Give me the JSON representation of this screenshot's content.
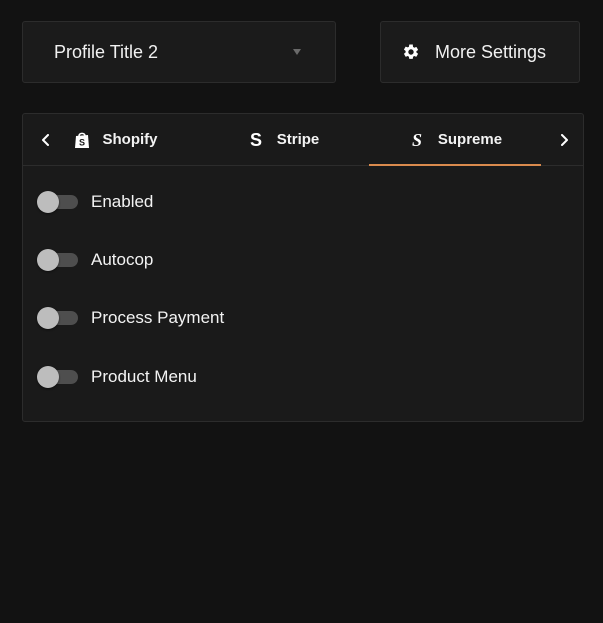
{
  "profile": {
    "selected": "Profile Title 2"
  },
  "more_settings": {
    "label": "More Settings",
    "icon": "gear-icon"
  },
  "tabs": {
    "items": [
      {
        "label": "Shopify",
        "icon": "shopify-bag-icon",
        "active": false
      },
      {
        "label": "Stripe",
        "icon": "stripe-s-icon",
        "active": false
      },
      {
        "label": "Supreme",
        "icon": "supreme-s-icon",
        "active": true
      }
    ],
    "accent_color": "#d98a4d"
  },
  "toggles": [
    {
      "label": "Enabled",
      "on": false
    },
    {
      "label": "Autocop",
      "on": false
    },
    {
      "label": "Process Payment",
      "on": false
    },
    {
      "label": "Product Menu",
      "on": false
    }
  ]
}
